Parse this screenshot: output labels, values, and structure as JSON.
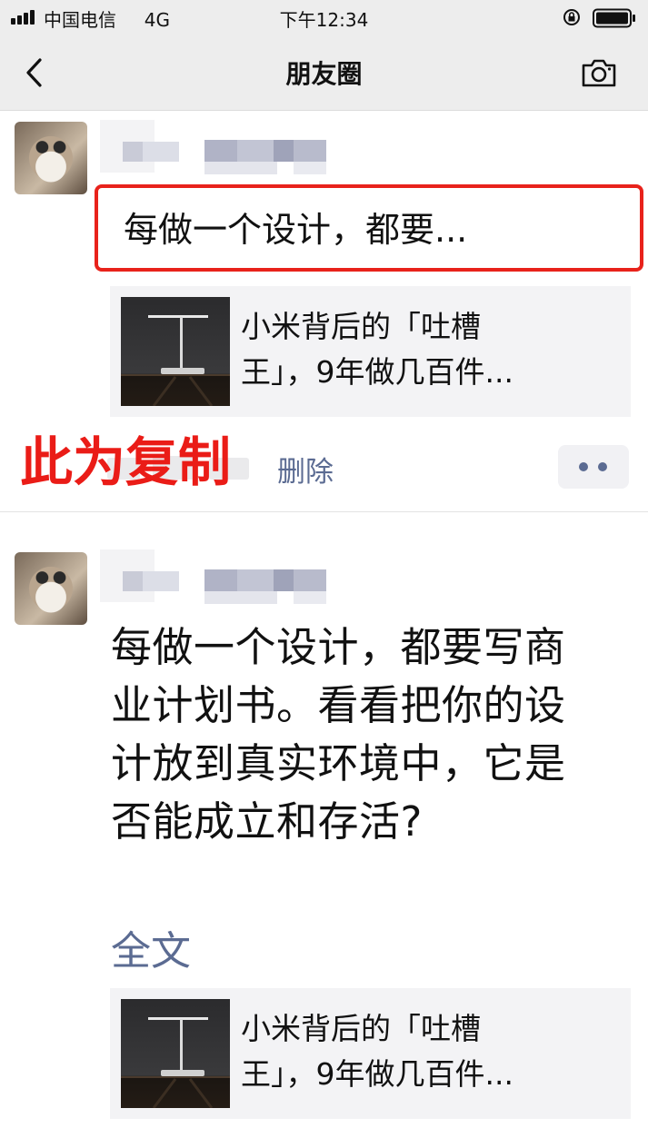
{
  "status_bar": {
    "carrier": "中国电信",
    "network": "4G",
    "time": "下午12:34"
  },
  "nav": {
    "title": "朋友圈"
  },
  "posts": [
    {
      "collapsed_text": "每做一个设计，都要...",
      "link_card": {
        "title_line1": "小米背后的「吐槽",
        "title_line2": "王」，9年做几百件..."
      },
      "overlay_label": "此为复制",
      "delete_label": "删除"
    },
    {
      "text_lines": [
        "每做一个设计，都要写商",
        "业计划书。看看把你的设",
        "计放到真实环境中，它是",
        "否能成立和存活?"
      ],
      "full_text_label": "全文",
      "link_card": {
        "title_line1": "小米背后的「吐槽",
        "title_line2": "王」，9年做几百件..."
      }
    }
  ],
  "colors": {
    "highlight_red": "#e8221b",
    "link_blue": "#5b6b92",
    "nav_bg": "#ededed",
    "card_bg": "#f3f3f5"
  },
  "icons": {
    "back": "chevron-left-icon",
    "camera": "camera-icon",
    "signal": "signal-icon",
    "lock": "rotation-lock-icon",
    "battery": "battery-icon",
    "more": "more-dots-icon"
  }
}
